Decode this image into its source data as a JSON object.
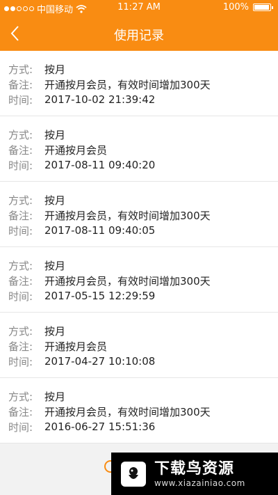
{
  "status_bar": {
    "carrier": "中国移动",
    "time": "11:27 AM",
    "battery": "100%"
  },
  "header": {
    "title": "使用记录"
  },
  "labels": {
    "method": "方式:",
    "note": "备注:",
    "time": "时间:"
  },
  "records": [
    {
      "method": "按月",
      "note": "开通按月会员，有效时间增加300天",
      "time": "2017-10-02 21:39:42"
    },
    {
      "method": "按月",
      "note": "开通按月会员",
      "time": "2017-08-11 09:40:20"
    },
    {
      "method": "按月",
      "note": "开通按月会员，有效时间增加300天",
      "time": "2017-08-11 09:40:05"
    },
    {
      "method": "按月",
      "note": "开通按月会员，有效时间增加300天",
      "time": "2017-05-15 12:29:59"
    },
    {
      "method": "按月",
      "note": "开通按月会员",
      "time": "2017-04-27 10:10:08"
    },
    {
      "method": "按月",
      "note": "开通按月会员，有效时间增加300天",
      "time": "2016-06-27 15:51:36"
    }
  ],
  "watermark": {
    "title": "下载鸟资源",
    "url": "www.xiazainiao.com"
  },
  "colors": {
    "brand": "#f98c12"
  }
}
